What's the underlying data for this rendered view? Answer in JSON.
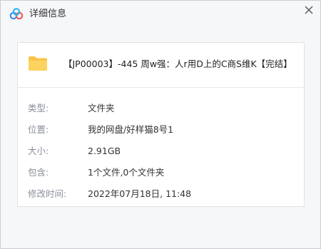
{
  "window": {
    "title": "详细信息"
  },
  "icons": {
    "app_logo": "baidu-netdisk-logo-icon",
    "close": "close-icon",
    "folder": "folder-icon"
  },
  "colors": {
    "logo_blue": "#3a8ff5",
    "logo_red": "#f05a5a",
    "folder_yellow": "#f8c44a",
    "label_gray": "#8a8f99"
  },
  "file": {
    "name": "【JP00003】-445 周w强：人r用D上的C商S维K【完结】"
  },
  "properties": [
    {
      "label": "类型:",
      "value": "文件夹"
    },
    {
      "label": "位置:",
      "value": "我的网盘/好样猫8号1"
    },
    {
      "label": "大小:",
      "value": "2.91GB"
    },
    {
      "label": "包含:",
      "value": "1个文件,0个文件夹"
    },
    {
      "label": "修改时间:",
      "value": "2022年07月18日, 11:48"
    }
  ]
}
